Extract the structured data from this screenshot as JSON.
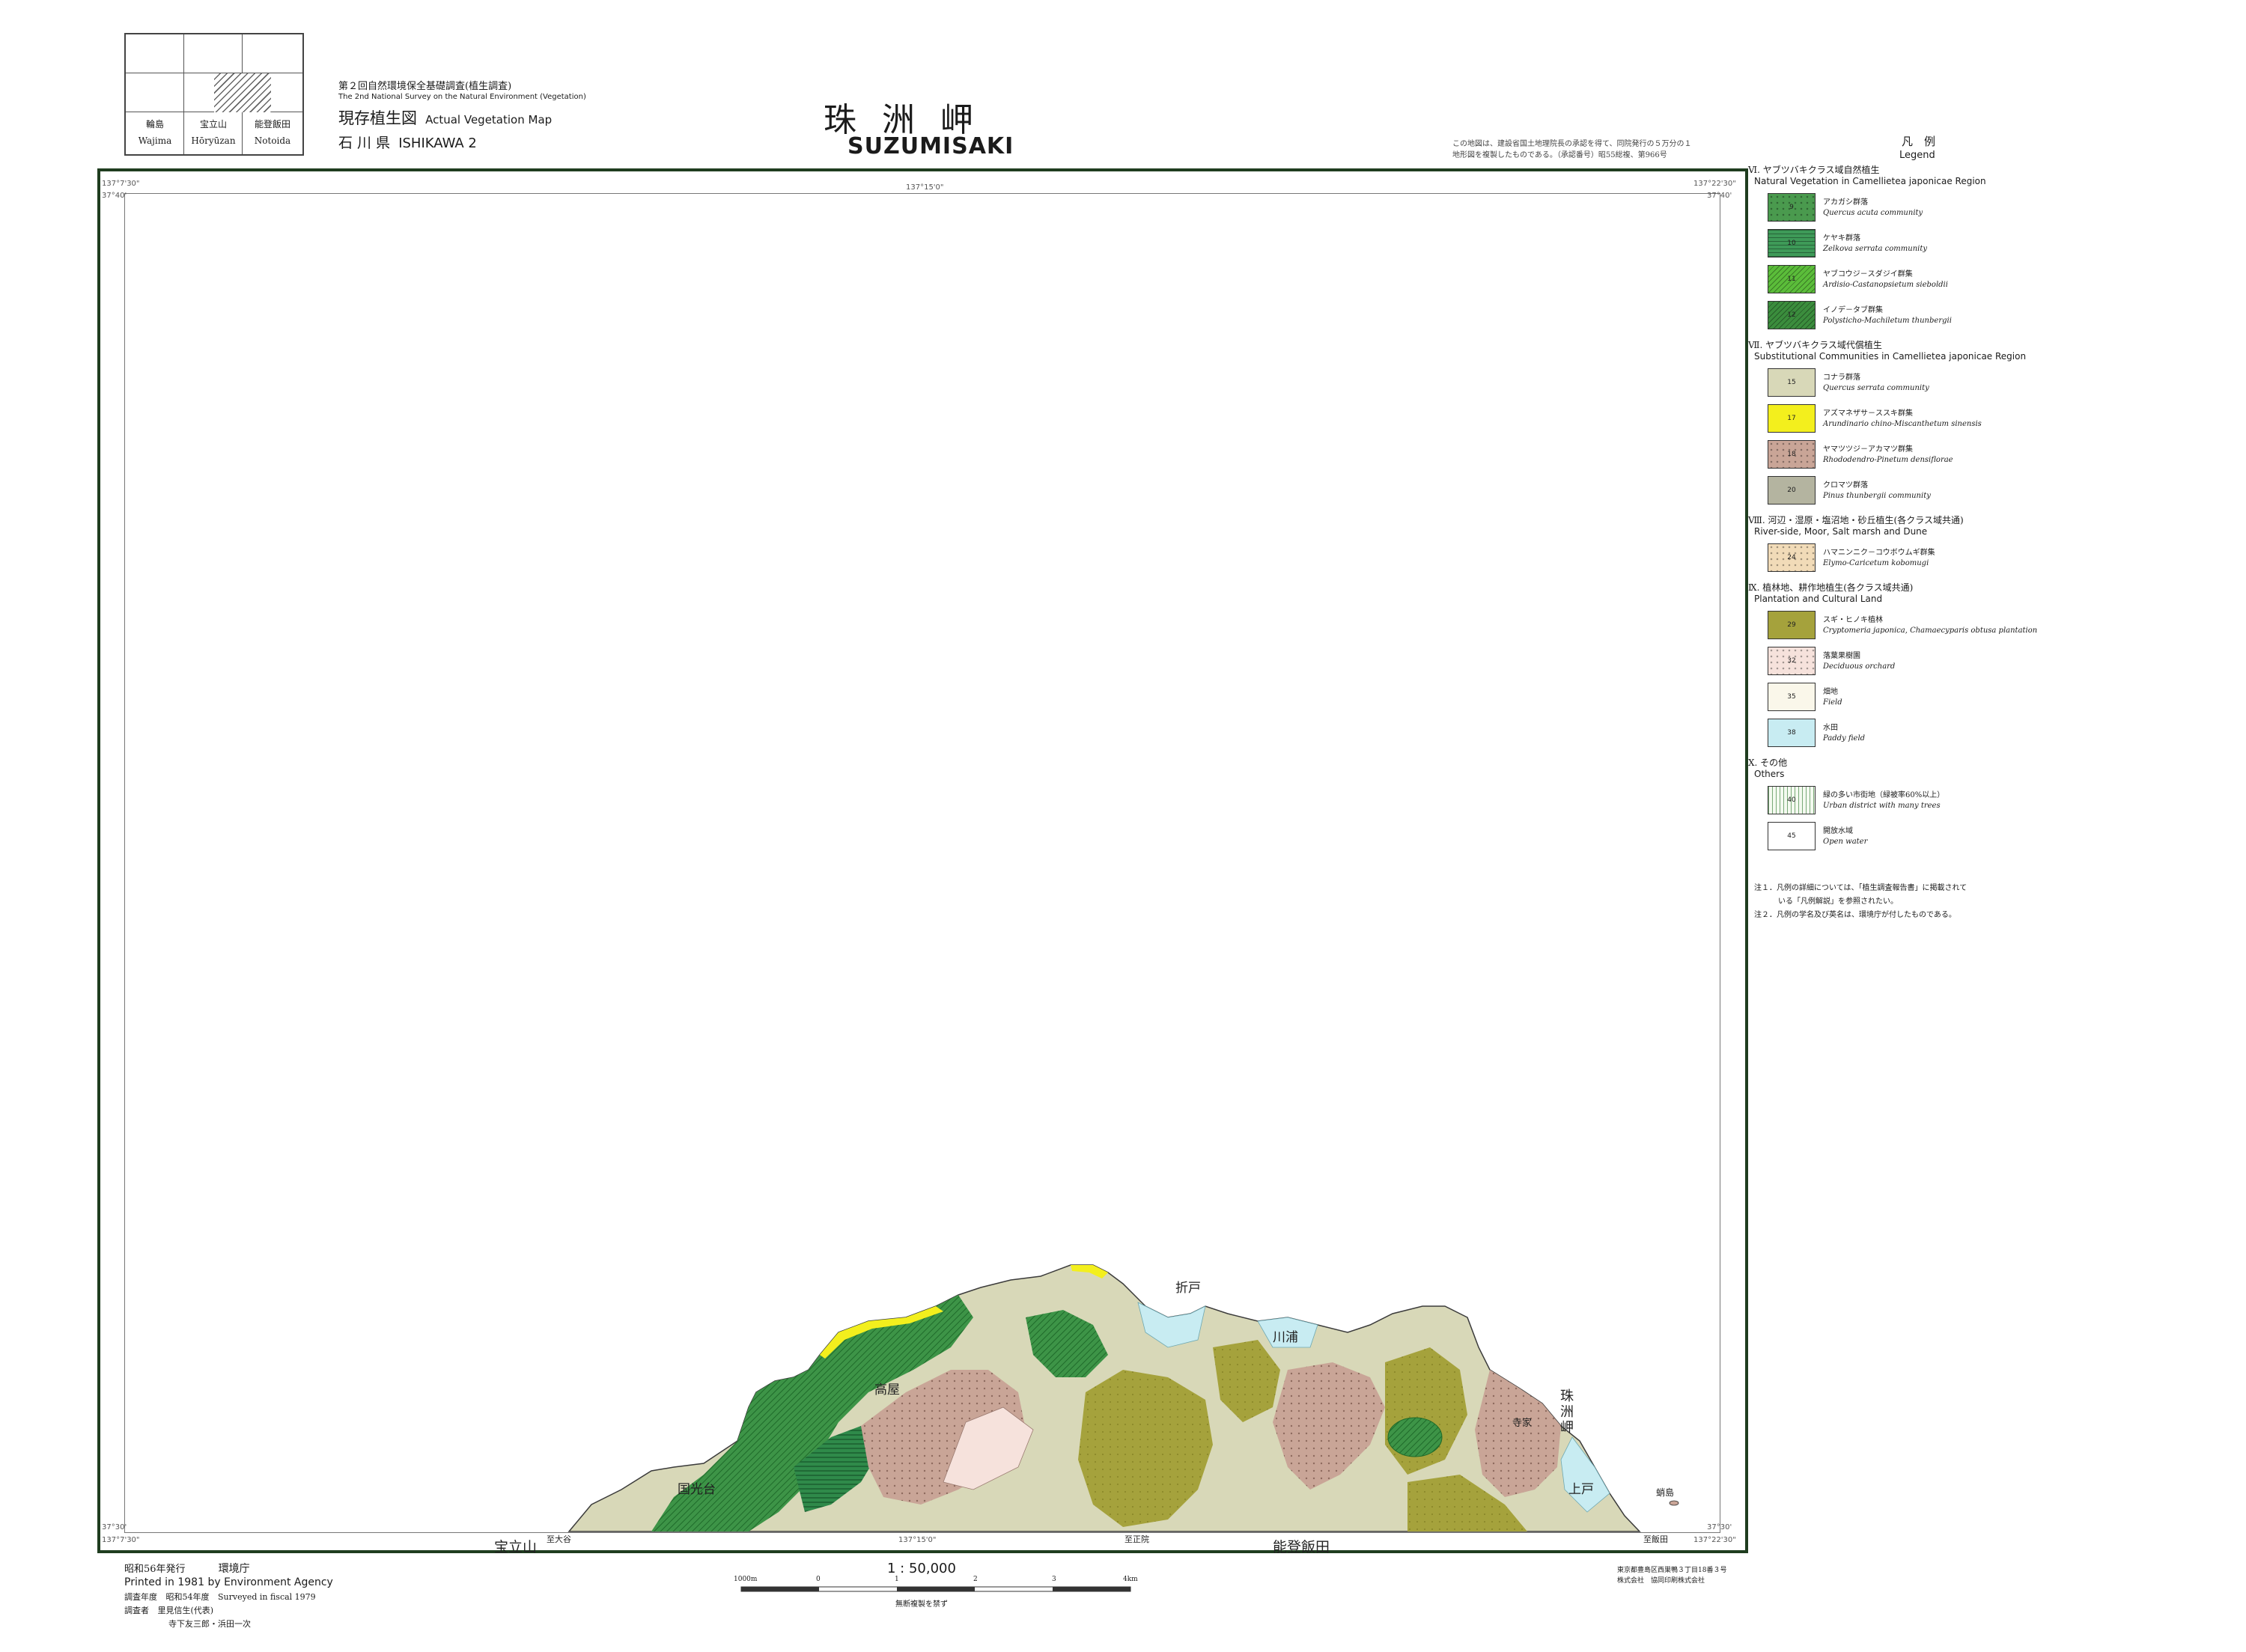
{
  "index_map": {
    "cells": [
      "輪島",
      "宝立山",
      "能登飯田"
    ],
    "cells_romaji": [
      "Wajima",
      "Hōryūzan",
      "Notoida"
    ]
  },
  "header": {
    "survey_ja": "第２回自然環境保全基礎調査(植生調査)",
    "survey_en": "The 2nd National Survey on the Natural Environment (Vegetation)",
    "map_type_ja": "現存植生図",
    "map_type_en": "Actual Vegetation Map",
    "prefecture_ja": "石 川 県",
    "prefecture_en": "ISHIKAWA 2",
    "title_ja": "珠洲岬",
    "title_en": "SUZUMISAKI",
    "copyright_note_1": "この地図は、建設省国土地理院長の承認を得て、同院発行の５万分の１",
    "copyright_note_2": "地形図を複製したものである。（承認番号）昭55総複、第966号"
  },
  "map": {
    "corner_top_left_lon": "137°7'30\"",
    "corner_top_left_lat": "37°40'",
    "corner_top_mid_lon": "137°15'0\"",
    "corner_top_right_lon": "137°22'30\"",
    "corner_top_right_lat": "37°40'",
    "corner_bottom_left_lon": "137°7'30\"",
    "corner_bottom_left_lat": "37°30'",
    "corner_bottom_mid_lon": "137°15'0\"",
    "corner_bottom_right_lon": "137°22'30\"",
    "corner_bottom_right_lat": "37°30'",
    "adjacent_south_left": "宝立山",
    "adjacent_south_right": "能登飯田",
    "bottom_edge_labels": [
      "至大谷",
      "至正院",
      "至飯田"
    ],
    "place_names": [
      "高屋",
      "国光台",
      "折戸",
      "川浦",
      "上戸",
      "寺家"
    ],
    "place_name_vertical": "珠洲岬",
    "island_label": "蛸島"
  },
  "legend": {
    "title_ja": "凡　例",
    "title_en": "Legend",
    "sections": [
      {
        "heading_ja": "Ⅵ. ヤブツバキクラス域自然植生",
        "heading_en": "Natural Vegetation in Camellietea japonicae Region",
        "items": [
          {
            "code": "9",
            "ja": "アカガシ群落",
            "en": "Quercus acuta community",
            "color": "#4a9a4e",
            "pattern": "dots"
          },
          {
            "code": "10",
            "ja": "ケヤキ群落",
            "en": "Zelkova serrata community",
            "color": "#3e9a58",
            "pattern": "hlines"
          },
          {
            "code": "11",
            "ja": "ヤブコウジ－スダジイ群集",
            "en": "Ardisio-Castanopsietum sieboldii",
            "color": "#5bbd3a",
            "pattern": "diag"
          },
          {
            "code": "12",
            "ja": "イノデ－タブ群集",
            "en": "Polysticho-Machiletum thunbergii",
            "color": "#3b8d3d",
            "pattern": "diag"
          }
        ]
      },
      {
        "heading_ja": "Ⅶ. ヤブツバキクラス域代償植生",
        "heading_en": "Substitutional Communities in Camellietea japonicae Region",
        "items": [
          {
            "code": "15",
            "ja": "コナラ群落",
            "en": "Quercus serrata community",
            "color": "#d8d8b8",
            "pattern": "none"
          },
          {
            "code": "17",
            "ja": "アズマネザサ－ススキ群集",
            "en": "Arundinario chino-Miscanthetum sinensis",
            "color": "#f3ef1d",
            "pattern": "none"
          },
          {
            "code": "18",
            "ja": "ヤマツツジ－アカマツ群集",
            "en": "Rhododendro-Pinetum densiflorae",
            "color": "#c9a597",
            "pattern": "dots"
          },
          {
            "code": "20",
            "ja": "クロマツ群落",
            "en": "Pinus thunbergii community",
            "color": "#b4b4a0",
            "pattern": "none"
          }
        ]
      },
      {
        "heading_ja": "Ⅷ. 河辺・湿原・塩沼地・砂丘植生(各クラス域共通)",
        "heading_en": "River-side, Moor, Salt marsh and Dune",
        "items": [
          {
            "code": "24",
            "ja": "ハマニンニク－コウボウムギ群集",
            "en": "Elymo-Caricetum kobomugi",
            "color": "#f1dbb8",
            "pattern": "dots"
          }
        ]
      },
      {
        "heading_ja": "Ⅸ. 植林地、耕作地植生(各クラス域共通)",
        "heading_en": "Plantation and Cultural Land",
        "items": [
          {
            "code": "29",
            "ja": "スギ・ヒノキ植林",
            "en": "Cryptomeria japonica, Chamaecyparis obtusa plantation",
            "color": "#a5a23c",
            "pattern": "none"
          },
          {
            "code": "32",
            "ja": "落葉果樹園",
            "en": "Deciduous orchard",
            "color": "#f6e2dc",
            "pattern": "dots"
          },
          {
            "code": "35",
            "ja": "畑地",
            "en": "Field",
            "color": "#faf7ea",
            "pattern": "none"
          },
          {
            "code": "38",
            "ja": "水田",
            "en": "Paddy field",
            "color": "#c8ecf2",
            "pattern": "none"
          }
        ]
      },
      {
        "heading_ja": "Ⅹ. その他",
        "heading_en": "Others",
        "items": [
          {
            "code": "40",
            "ja": "緑の多い市街地（緑被率60%以上）",
            "en": "Urban district with many trees",
            "color": "#f4faf0",
            "pattern": "vlines"
          },
          {
            "code": "45",
            "ja": "開放水域",
            "en": "Open water",
            "color": "#ffffff",
            "pattern": "none"
          }
        ]
      }
    ],
    "notes": [
      "注１．凡例の詳細については、「植生調査報告書」に掲載されて",
      "いる「凡例解説」を参照されたい。",
      "注２．凡例の学名及び英名は、環境庁が付したものである。"
    ]
  },
  "footer": {
    "publish_ja": "昭和56年発行",
    "publisher_ja": "環境庁",
    "publish_en": "Printed in 1981 by Environment Agency",
    "survey_year_label": "調査年度",
    "survey_year_ja": "昭和54年度",
    "survey_year_en": "Surveyed in fiscal 1979",
    "surveyors_label": "調査者",
    "surveyors_1": "里見信生(代表)",
    "surveyors_2": "寺下友三郎・浜田一次",
    "scale": "1 : 50,000",
    "scale_ticks": [
      "1000m",
      "0",
      "1",
      "2",
      "3",
      "4km"
    ],
    "copy_prohibited": "無断複製を禁ず",
    "printer_1": "東京都豊島区西巣鴨３丁目18番３号",
    "printer_2": "株式会社　協同印刷株式会社"
  }
}
